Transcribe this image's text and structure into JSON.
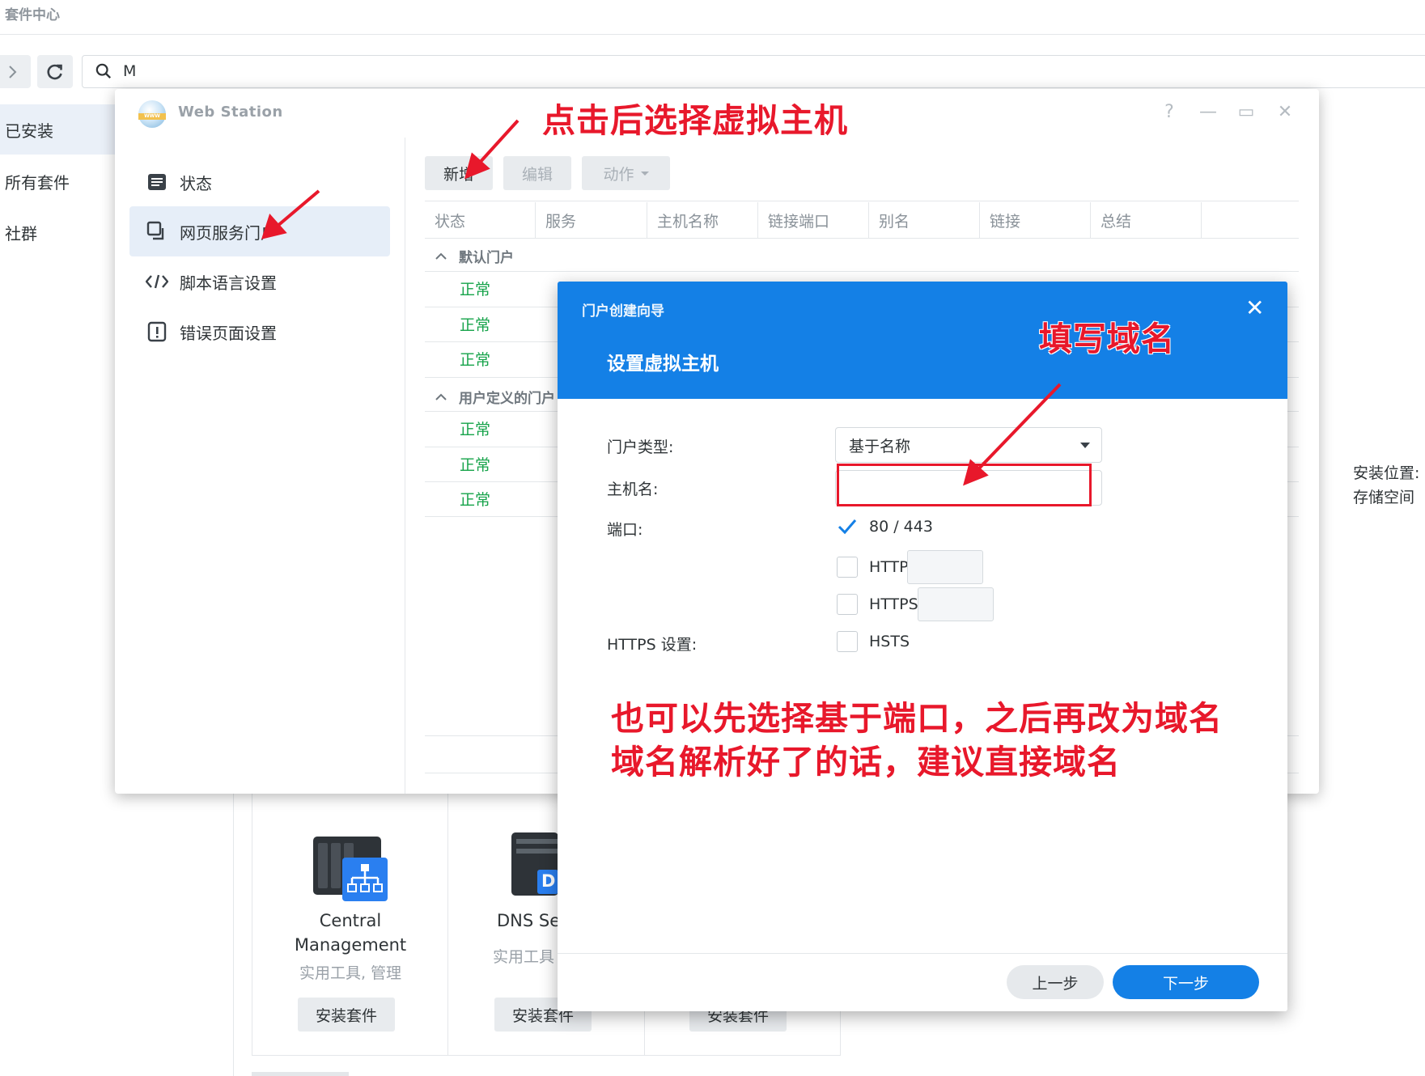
{
  "package_center": {
    "title": "套件中心",
    "search_value": "M",
    "nav": [
      "已安装",
      "所有套件",
      "社群"
    ],
    "right_labels": [
      "安装位置:",
      "存储空间"
    ],
    "packages": [
      {
        "name_line1": "Central",
        "name_line2": "Management",
        "category": "实用工具, 管理",
        "install": "安装套件"
      },
      {
        "name_line1": "DNS Se",
        "name_line2": "",
        "category": "实用工具",
        "install": "安装套件"
      },
      {
        "name_line1": "",
        "name_line2": "",
        "category": "",
        "install": "安装套件"
      }
    ],
    "dns_icon_text": "D"
  },
  "web_station": {
    "title": "Web Station",
    "logo_text": "WWW",
    "controls": [
      "?",
      "—",
      "▭",
      "✕"
    ],
    "sidebar": [
      {
        "icon": "status-icon",
        "label": "状态"
      },
      {
        "icon": "web-portal-icon",
        "label": "网页服务门户"
      },
      {
        "icon": "code-icon",
        "label": "脚本语言设置"
      },
      {
        "icon": "error-page-icon",
        "label": "错误页面设置"
      }
    ],
    "toolbar": {
      "add": "新增",
      "edit": "编辑",
      "action": "动作"
    },
    "columns": [
      "状态",
      "服务",
      "主机名称",
      "链接端口",
      "别名",
      "链接",
      "总结"
    ],
    "groups": {
      "default": "默认门户",
      "user": "用户定义的门户"
    },
    "default_rows": [
      "正常",
      "正常",
      "正常"
    ],
    "user_rows": [
      "正常",
      "正常",
      "正常"
    ]
  },
  "wizard": {
    "small_title": "门户创建向导",
    "title": "设置虚拟主机",
    "close": "✕",
    "labels": {
      "portal_type": "门户类型:",
      "hostname": "主机名:",
      "port": "端口:",
      "https_settings": "HTTPS 设置:"
    },
    "portal_type_value": "基于名称",
    "hostname_value": "",
    "port_options": [
      {
        "label": "80 / 443",
        "checked": true
      },
      {
        "label": "HTTP",
        "checked": false
      },
      {
        "label": "HTTPS",
        "checked": false
      }
    ],
    "hsts": {
      "label": "HSTS",
      "checked": false
    },
    "buttons": {
      "prev": "上一步",
      "next": "下一步"
    }
  },
  "annotations": {
    "top": "点击后选择虚拟主机",
    "domain": "填写域名",
    "note_line1": "也可以先选择基于端口，之后再改为域名",
    "note_line2": "域名解析好了的话，建议直接域名"
  },
  "colors": {
    "accent": "#1480e6",
    "annotation": "#e8182b",
    "status_ok": "#16a34a"
  }
}
